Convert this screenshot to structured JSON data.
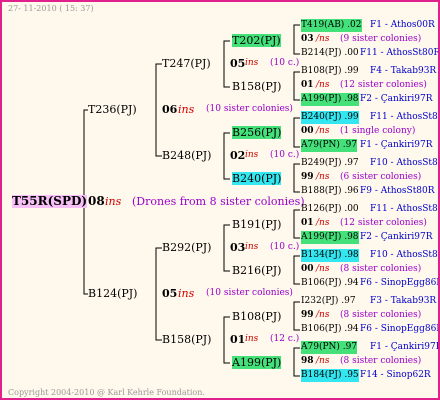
{
  "header": "27- 11-2010 ( 15: 37)",
  "footer": "Copyright 2004-2010 @ Karl Kehrle Foundation.",
  "root": {
    "name": "T55R(SPD)",
    "num": "08",
    "ins": "ins",
    "note": "(Drones from 8 sister colonies)"
  },
  "gen1": [
    {
      "name": "T236(PJ)",
      "num": "06",
      "ins": "ins",
      "note": "(10 sister colonies)"
    },
    {
      "name": "B124(PJ)",
      "num": "05",
      "ins": "ins",
      "note": "(10 sister colonies)"
    }
  ],
  "gen2": [
    {
      "name": "T247(PJ)",
      "num": "05",
      "ins": "ins",
      "note": "(10 c.)"
    },
    {
      "name": "B248(PJ)",
      "num": "02",
      "ins": "ins",
      "note": "(10 c.)"
    },
    {
      "name": "B292(PJ)",
      "num": "03",
      "ins": "ins",
      "note": "(10 c.)"
    },
    {
      "name": "B158(PJ)",
      "num": "01",
      "ins": "ins",
      "note": "(12 c.)"
    }
  ],
  "gen3": [
    "T202(PJ)",
    "B158(PJ)",
    "B256(PJ)",
    "B240(PJ)",
    "B191(PJ)",
    "B216(PJ)",
    "B108(PJ)",
    "A199(PJ)"
  ],
  "gen4": [
    {
      "top": "T419(AB) .02",
      "top_loc": "F1 - Athos00R",
      "num": "03",
      "ins": "/ns",
      "note": "(9 sister colonies)",
      "bot": "B214(PJ) .00",
      "bot_loc": "F11 - AthosSt80R"
    },
    {
      "top": "B108(PJ) .99",
      "top_loc": "F4 - Takab93R",
      "num": "01",
      "ins": "/ns",
      "note": "(12 sister colonies)",
      "bot": "A199(PJ) .98",
      "bot_loc": "F2 - Çankiri97R"
    },
    {
      "top": "B240(PJ) .99",
      "top_loc": "F11 - AthosSt80R",
      "num": "00",
      "ins": "/ns",
      "note": "(1 single colony)",
      "bot": "A79(PN) .97",
      "bot_loc": "F1 - Çankiri97R"
    },
    {
      "top": "B249(PJ) .97",
      "top_loc": "F10 - AthosSt80R",
      "num": "99",
      "ins": "/ns",
      "note": "(6 sister colonies)",
      "bot": "B188(PJ) .96",
      "bot_loc": "F9 - AthosSt80R"
    },
    {
      "top": "B126(PJ) .00",
      "top_loc": "F11 - AthosSt80R",
      "num": "01",
      "ins": "/ns",
      "note": "(12 sister colonies)",
      "bot": "A199(PJ) .98",
      "bot_loc": "F2 - Çankiri97R"
    },
    {
      "top": "B134(PJ) .98",
      "top_loc": "F10 - AthosSt80R",
      "num": "00",
      "ins": "/ns",
      "note": "(8 sister colonies)",
      "bot": "B106(PJ) .94",
      "bot_loc": "F6 - SinopEgg86R"
    },
    {
      "top": "I232(PJ) .97",
      "top_loc": "F3 - Takab93R",
      "num": "99",
      "ins": "/ns",
      "note": "(8 sister colonies)",
      "bot": "B106(PJ) .94",
      "bot_loc": "F6 - SinopEgg86R"
    },
    {
      "top": "A79(PN) .97",
      "top_loc": "F1 - Çankiri97R",
      "num": "98",
      "ins": "/ns",
      "note": "(8 sister colonies)",
      "bot": "B184(PJ) .95",
      "bot_loc": "F14 - Sinop62R"
    }
  ],
  "colors": {
    "border": "#e0208c",
    "background": "#fff8ec",
    "green": "#44e07a",
    "cyan": "#33e6f0",
    "pink": "#f7c0f7",
    "red": "#cc0000",
    "purple": "#9900cc",
    "blue": "#0000cc"
  }
}
